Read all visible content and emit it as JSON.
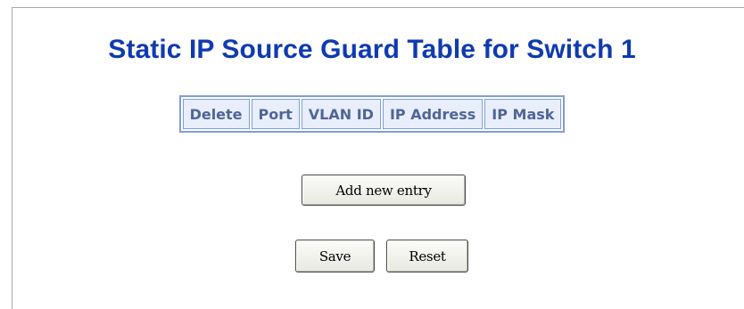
{
  "page": {
    "title": "Static IP Source Guard Table for Switch 1"
  },
  "table": {
    "columns": [
      "Delete",
      "Port",
      "VLAN ID",
      "IP Address",
      "IP Mask"
    ],
    "rows": []
  },
  "buttons": {
    "add_new_entry": "Add new entry",
    "save": "Save",
    "reset": "Reset"
  },
  "colors": {
    "title": "#0f3ab0",
    "table_border": "#7f9ed8",
    "header_bg": "#e8eefb",
    "header_text": "#4f6596"
  }
}
